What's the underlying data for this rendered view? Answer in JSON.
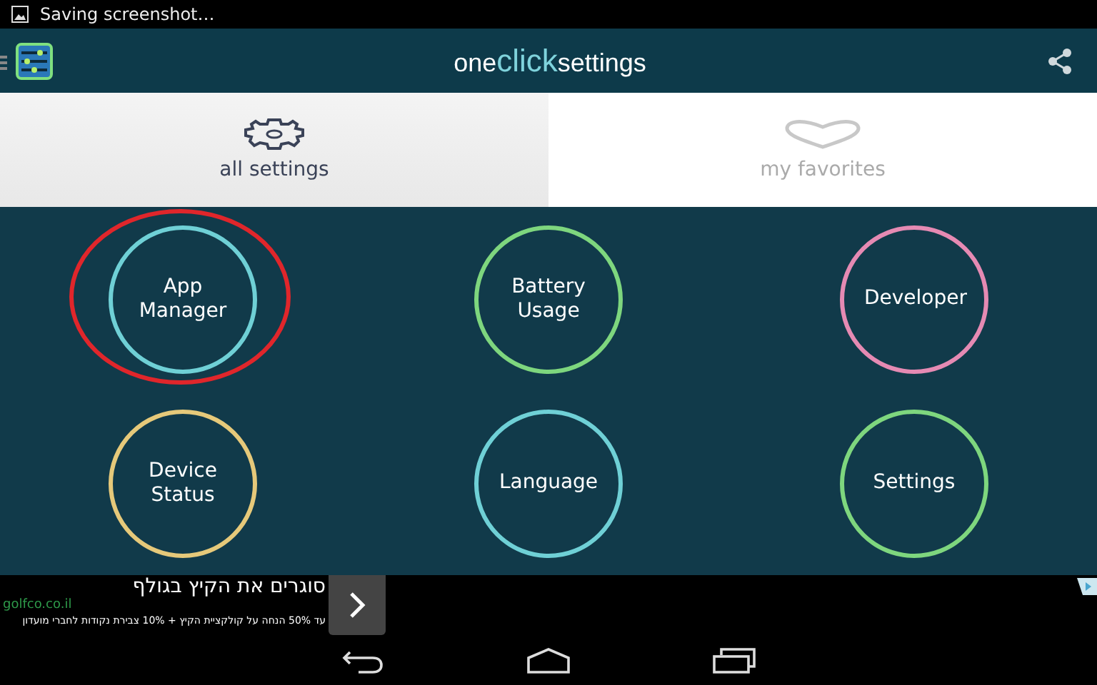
{
  "status_bar": {
    "notification": "Saving screenshot…"
  },
  "app_title": [
    {
      "text": "one",
      "accent": false
    },
    {
      "text": "click",
      "accent": true
    },
    {
      "text": "settings",
      "accent": false
    }
  ],
  "tabs": [
    {
      "label": "all settings",
      "selected": true,
      "kind": "gear"
    },
    {
      "label": "my favorites",
      "selected": false,
      "kind": "heart"
    }
  ],
  "items": [
    {
      "label": "App Manager",
      "color": "#6fd0d6",
      "highlighted": true
    },
    {
      "label": "Battery Usage",
      "color": "#7ed67e",
      "highlighted": false
    },
    {
      "label": "Developer",
      "color": "#e58ab3",
      "highlighted": false
    },
    {
      "label": "Device Status",
      "color": "#e6c97a",
      "highlighted": false
    },
    {
      "label": "Language",
      "color": "#6fd0d6",
      "highlighted": false
    },
    {
      "label": "Settings",
      "color": "#7ed67e",
      "highlighted": false
    }
  ],
  "ad": {
    "headline": "סוגרים את הקיץ בגולף",
    "url": "golfco.co.il",
    "body": "עד 50% הנחה על קולקציית הקיץ + 10% צבירת נקודות לחברי מועדון"
  }
}
